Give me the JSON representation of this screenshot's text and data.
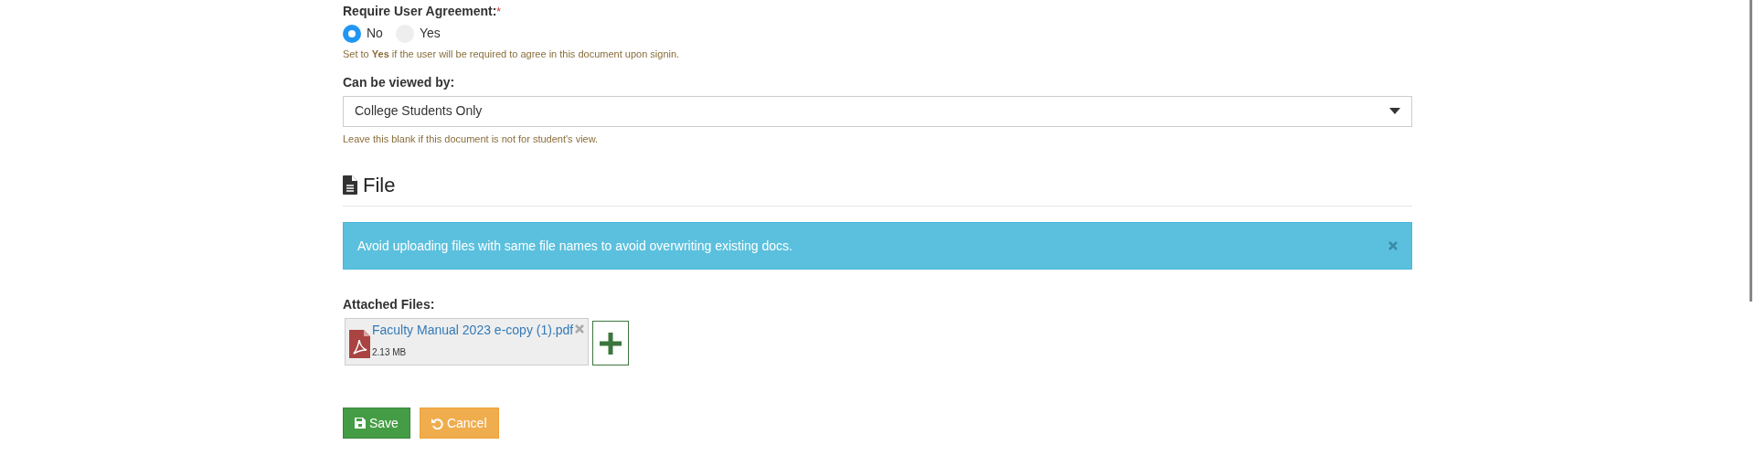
{
  "agreement": {
    "label": "Require User Agreement:",
    "required_mark": "*",
    "options": [
      {
        "label": "No",
        "selected": true
      },
      {
        "label": "Yes",
        "selected": false
      }
    ],
    "help": "Set to **Yes** if the user will be required to agree in this document upon signin."
  },
  "viewed_by": {
    "label": "Can be viewed by:",
    "value": "College Students Only",
    "help": "Leave this blank if this document is not for student's view."
  },
  "file_section": {
    "title": "File",
    "alert": "Avoid uploading files with same file names to avoid overwriting existing docs.",
    "attached_label": "Attached Files:",
    "files": [
      {
        "name": "Faculty Manual 2023 e-copy (1).pdf",
        "size": "2.13 MB"
      }
    ]
  },
  "buttons": [
    {
      "kind": "save",
      "label": "Save"
    },
    {
      "kind": "cancel",
      "label": "Cancel"
    }
  ]
}
